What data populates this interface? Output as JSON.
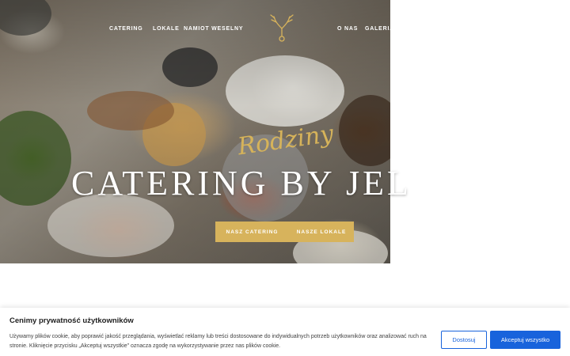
{
  "nav": {
    "items": [
      {
        "label": "CATERING"
      },
      {
        "label": "LOKALE"
      },
      {
        "label": "NAMIOT WESELNY"
      },
      {
        "label": "O NAS"
      },
      {
        "label": "GALERIA"
      }
    ]
  },
  "hero": {
    "script_title": "Rodziny",
    "title": "CATERING BY JEL",
    "buttons": {
      "catering": "NASZ CATERING",
      "lokale": "NASZE LOKALE"
    }
  },
  "cookie": {
    "title": "Cenimy prywatność użytkowników",
    "text": "Używamy plików cookie, aby poprawić jakość przeglądania, wyświetlać reklamy lub treści dostosowane do indywidualnych potrzeb użytkowników oraz analizować ruch na stronie. Kliknięcie przycisku „Akceptuj wszystkie\" oznacza zgodę na wykorzystywanie przez nas plików cookie.",
    "customize_label": "Dostosuj",
    "accept_label": "Akceptuj wszystko"
  },
  "colors": {
    "gold": "#d7b35c",
    "accent_blue": "#1863dc"
  },
  "icons": {
    "logo": "deer-antlers-logo"
  }
}
